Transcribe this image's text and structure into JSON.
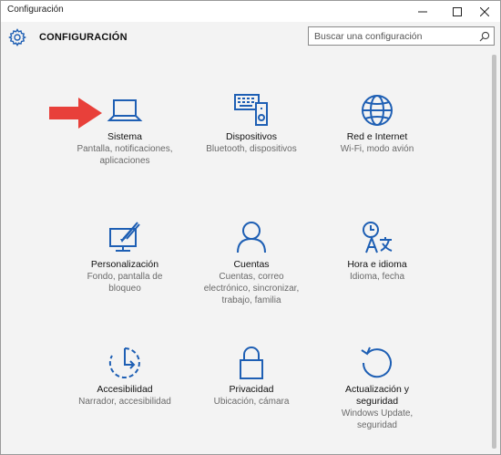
{
  "window": {
    "title": "Configuración",
    "controls": [
      "minimize-icon",
      "maximize-icon",
      "close-icon"
    ]
  },
  "header": {
    "heading": "CONFIGURACIÓN",
    "icon": "gear-icon"
  },
  "search": {
    "placeholder": "Buscar una configuración",
    "icon": "search-icon"
  },
  "colors": {
    "accent": "#1e5fb4",
    "arrow": "#e8403a",
    "background": "#f3f3f3"
  },
  "tiles": [
    {
      "name": "Sistema",
      "desc_lines": [
        "Pantalla, notificaciones,",
        "aplicaciones"
      ],
      "icon": "laptop-icon"
    },
    {
      "name": "Dispositivos",
      "desc_lines": [
        "Bluetooth, dispositivos"
      ],
      "icon": "devices-icon"
    },
    {
      "name": "Red e Internet",
      "desc_lines": [
        "Wi-Fi, modo avión"
      ],
      "icon": "globe-icon"
    },
    {
      "name": "Personalización",
      "desc_lines": [
        "Fondo, pantalla de",
        "bloqueo"
      ],
      "icon": "personalization-icon"
    },
    {
      "name": "Cuentas",
      "desc_lines": [
        "Cuentas, correo",
        "electrónico, sincronizar,",
        "trabajo, familia"
      ],
      "icon": "person-icon"
    },
    {
      "name": "Hora e idioma",
      "desc_lines": [
        "Idioma, fecha"
      ],
      "icon": "time-language-icon"
    },
    {
      "name": "Accesibilidad",
      "desc_lines": [
        "Narrador, accesibilidad"
      ],
      "icon": "ease-of-access-icon"
    },
    {
      "name": "Privacidad",
      "desc_lines": [
        "Ubicación, cámara"
      ],
      "icon": "lock-icon"
    },
    {
      "name": "Actualización y\nseguridad",
      "name_lines": [
        "Actualización y",
        "seguridad"
      ],
      "desc_lines": [
        "Windows Update,",
        "seguridad"
      ],
      "icon": "update-icon"
    }
  ]
}
